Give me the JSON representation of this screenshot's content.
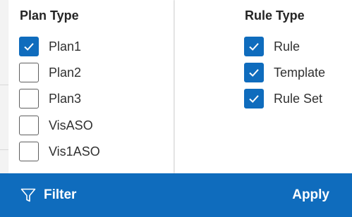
{
  "plan_type": {
    "heading": "Plan Type",
    "options": [
      {
        "label": "Plan1",
        "checked": true
      },
      {
        "label": "Plan2",
        "checked": false
      },
      {
        "label": "Plan3",
        "checked": false
      },
      {
        "label": "VisASO",
        "checked": false
      },
      {
        "label": "Vis1ASO",
        "checked": false
      }
    ]
  },
  "rule_type": {
    "heading": "Rule Type",
    "options": [
      {
        "label": "Rule",
        "checked": true
      },
      {
        "label": "Template",
        "checked": true
      },
      {
        "label": "Rule Set",
        "checked": true
      }
    ]
  },
  "footer": {
    "filter_label": "Filter",
    "filter_icon": "funnel-icon",
    "apply_label": "Apply"
  },
  "colors": {
    "accent": "#0f6cbd",
    "panel_bg": "#ffffff",
    "page_bg": "#f3f3f3"
  }
}
